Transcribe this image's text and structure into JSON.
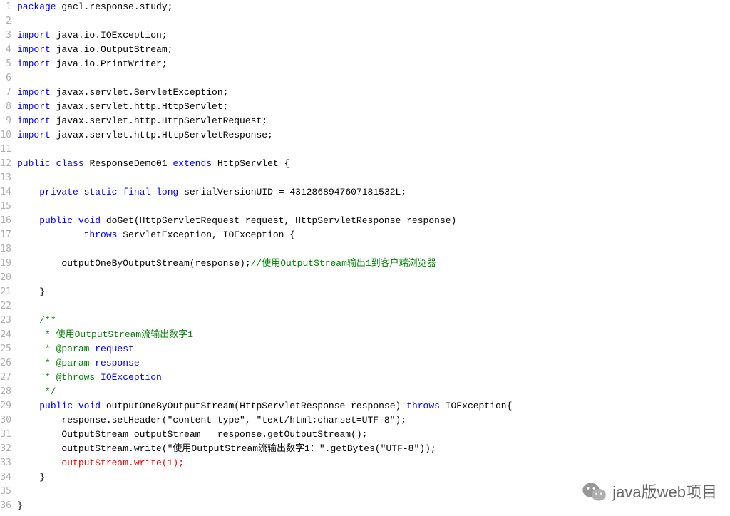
{
  "code": {
    "lines": [
      [
        {
          "t": "package",
          "c": "kw"
        },
        {
          "t": " gacl.response.study;",
          "c": "plain"
        }
      ],
      [],
      [
        {
          "t": "import",
          "c": "kw"
        },
        {
          "t": " java.io.IOException;",
          "c": "plain"
        }
      ],
      [
        {
          "t": "import",
          "c": "kw"
        },
        {
          "t": " java.io.OutputStream;",
          "c": "plain"
        }
      ],
      [
        {
          "t": "import",
          "c": "kw"
        },
        {
          "t": " java.io.PrintWriter;",
          "c": "plain"
        }
      ],
      [],
      [
        {
          "t": "import",
          "c": "kw"
        },
        {
          "t": " javax.servlet.ServletException;",
          "c": "plain"
        }
      ],
      [
        {
          "t": "import",
          "c": "kw"
        },
        {
          "t": " javax.servlet.http.HttpServlet;",
          "c": "plain"
        }
      ],
      [
        {
          "t": "import",
          "c": "kw"
        },
        {
          "t": " javax.servlet.http.HttpServletRequest;",
          "c": "plain"
        }
      ],
      [
        {
          "t": "import",
          "c": "kw"
        },
        {
          "t": " javax.servlet.http.HttpServletResponse;",
          "c": "plain"
        }
      ],
      [],
      [
        {
          "t": "public",
          "c": "kw"
        },
        {
          "t": " ",
          "c": "plain"
        },
        {
          "t": "class",
          "c": "kw"
        },
        {
          "t": " ResponseDemo01 ",
          "c": "plain"
        },
        {
          "t": "extends",
          "c": "kw"
        },
        {
          "t": " HttpServlet {",
          "c": "plain"
        }
      ],
      [],
      [
        {
          "t": "    ",
          "c": "plain"
        },
        {
          "t": "private",
          "c": "kw"
        },
        {
          "t": " ",
          "c": "plain"
        },
        {
          "t": "static",
          "c": "kw"
        },
        {
          "t": " ",
          "c": "plain"
        },
        {
          "t": "final",
          "c": "kw"
        },
        {
          "t": " ",
          "c": "plain"
        },
        {
          "t": "long",
          "c": "kw"
        },
        {
          "t": " serialVersionUID = 4312868947607181532L;",
          "c": "plain"
        }
      ],
      [],
      [
        {
          "t": "    ",
          "c": "plain"
        },
        {
          "t": "public",
          "c": "kw"
        },
        {
          "t": " ",
          "c": "plain"
        },
        {
          "t": "void",
          "c": "kw"
        },
        {
          "t": " doGet(HttpServletRequest request, HttpServletResponse response)",
          "c": "plain"
        }
      ],
      [
        {
          "t": "            ",
          "c": "plain"
        },
        {
          "t": "throws",
          "c": "kw"
        },
        {
          "t": " ServletException, IOException {",
          "c": "plain"
        }
      ],
      [],
      [
        {
          "t": "        outputOneByOutputStream(response);",
          "c": "plain"
        },
        {
          "t": "//使用OutputStream输出1到客户端浏览器",
          "c": "comment"
        }
      ],
      [],
      [
        {
          "t": "    }",
          "c": "plain"
        }
      ],
      [],
      [
        {
          "t": "    ",
          "c": "plain"
        },
        {
          "t": "/**",
          "c": "comment"
        }
      ],
      [
        {
          "t": "     * 使用OutputStream流输出数字1",
          "c": "comment"
        }
      ],
      [
        {
          "t": "     * @param ",
          "c": "comment"
        },
        {
          "t": "request",
          "c": "kw"
        }
      ],
      [
        {
          "t": "     * @param ",
          "c": "comment"
        },
        {
          "t": "response",
          "c": "kw"
        }
      ],
      [
        {
          "t": "     * @throws ",
          "c": "comment"
        },
        {
          "t": "IOException",
          "c": "kw"
        }
      ],
      [
        {
          "t": "     */",
          "c": "comment"
        }
      ],
      [
        {
          "t": "    ",
          "c": "plain"
        },
        {
          "t": "public",
          "c": "kw"
        },
        {
          "t": " ",
          "c": "plain"
        },
        {
          "t": "void",
          "c": "kw"
        },
        {
          "t": " outputOneByOutputStream(HttpServletResponse response) ",
          "c": "plain"
        },
        {
          "t": "throws",
          "c": "kw"
        },
        {
          "t": " IOException{",
          "c": "plain"
        }
      ],
      [
        {
          "t": "        response.setHeader(\"content-type\", \"text/html;charset=UTF-8\");",
          "c": "plain"
        }
      ],
      [
        {
          "t": "        OutputStream outputStream = response.getOutputStream();",
          "c": "plain"
        }
      ],
      [
        {
          "t": "        outputStream.write(\"使用OutputStream流输出数字1：\".getBytes(\"UTF-8\"));",
          "c": "plain"
        }
      ],
      [
        {
          "t": "        outputStream.write(1);",
          "c": "hl-red2"
        }
      ],
      [
        {
          "t": "    }",
          "c": "plain"
        }
      ],
      [],
      [
        {
          "t": "}",
          "c": "plain"
        }
      ]
    ]
  },
  "watermark": {
    "text": "java版web项目"
  }
}
